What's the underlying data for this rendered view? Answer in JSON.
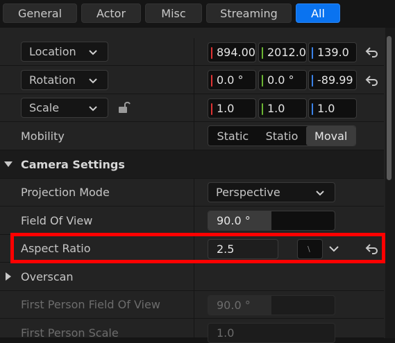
{
  "tabs": [
    "General",
    "Actor",
    "Misc",
    "Streaming",
    "All"
  ],
  "active_tab": "All",
  "transform": {
    "location": {
      "label": "Location",
      "x": "894.00",
      "y": "2012.0",
      "z": "139.0"
    },
    "rotation": {
      "label": "Rotation",
      "x": "0.0 °",
      "y": "0.0 °",
      "z": "-89.99"
    },
    "scale": {
      "label": "Scale",
      "x": "1.0",
      "y": "1.0",
      "z": "1.0"
    }
  },
  "mobility": {
    "label": "Mobility",
    "options": [
      "Static",
      "Statio",
      "Moval"
    ],
    "selected": "Moval"
  },
  "camera_settings": {
    "header": "Camera Settings",
    "projection_mode": {
      "label": "Projection Mode",
      "value": "Perspective"
    },
    "field_of_view": {
      "label": "Field Of View",
      "value": "90.0 °",
      "fill": 0.5
    },
    "aspect_ratio": {
      "label": "Aspect Ratio",
      "value": "2.5",
      "preset": "\\"
    },
    "overscan": {
      "label": "Overscan"
    },
    "first_person_fov": {
      "label": "First Person Field Of View",
      "value": "90.0 °",
      "fill": 0.5
    },
    "first_person_scale": {
      "label": "First Person Scale",
      "value": "1.0"
    }
  },
  "colors": {
    "x_axis": "#e03434",
    "y_axis": "#6ab432",
    "z_axis": "#3a82e8",
    "accent": "#0a73f0",
    "highlight": "#ff0000"
  }
}
